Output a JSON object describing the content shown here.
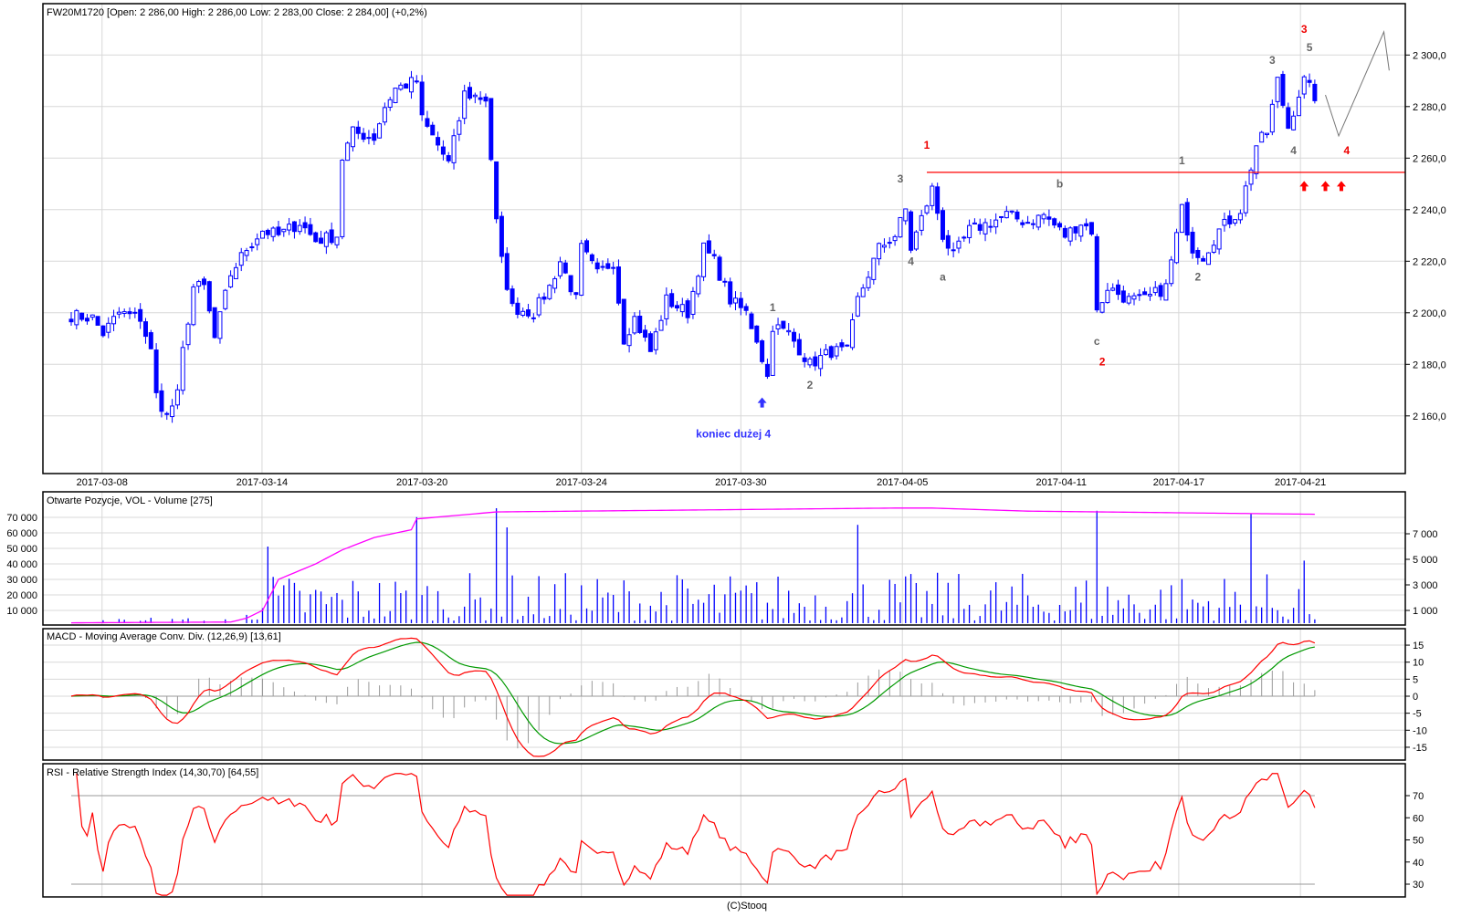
{
  "footer": "(C)Stooq",
  "chart_data": [
    {
      "type": "candlestick",
      "title": "FW20M1720 [Open: 2 286,00  High: 2 286,00  Low: 2 283,00  Close: 2 284,00] (+0,2%)",
      "ylim": [
        2140,
        2320
      ],
      "y_ticks": [
        {
          "value": 2160,
          "label": "2 160,0"
        },
        {
          "value": 2180,
          "label": "2 180,0"
        },
        {
          "value": 2200,
          "label": "2 200,0"
        },
        {
          "value": 2220,
          "label": "2 220,0"
        },
        {
          "value": 2240,
          "label": "2 240,0"
        },
        {
          "value": 2260,
          "label": "2 260,0"
        },
        {
          "value": 2280,
          "label": "2 280,0"
        },
        {
          "value": 2300,
          "label": "2 300,0"
        }
      ],
      "x_ticks": [
        {
          "bar": 5.8,
          "label": "2017-03-08"
        },
        {
          "bar": 35.9,
          "label": "2017-03-14"
        },
        {
          "bar": 66,
          "label": "2017-03-20"
        },
        {
          "bar": 96,
          "label": "2017-03-24"
        },
        {
          "bar": 126,
          "label": "2017-03-30"
        },
        {
          "bar": 156.4,
          "label": "2017-04-05"
        },
        {
          "bar": 186.3,
          "label": "2017-04-11"
        },
        {
          "bar": 208.4,
          "label": "2017-04-17"
        },
        {
          "bar": 231.3,
          "label": "2017-04-21"
        }
      ],
      "bar_count": 235,
      "close_path": [
        [
          0,
          2199
        ],
        [
          4,
          2198
        ],
        [
          6,
          2192
        ],
        [
          9,
          2200
        ],
        [
          13,
          2198
        ],
        [
          15,
          2185
        ],
        [
          16,
          2168
        ],
        [
          18,
          2160
        ],
        [
          20,
          2168
        ],
        [
          21,
          2185
        ],
        [
          23,
          2210
        ],
        [
          25,
          2210
        ],
        [
          27,
          2190
        ],
        [
          30,
          2215
        ],
        [
          33,
          2225
        ],
        [
          36,
          2232
        ],
        [
          39,
          2230
        ],
        [
          43,
          2235
        ],
        [
          46,
          2228
        ],
        [
          50,
          2230
        ],
        [
          51,
          2260
        ],
        [
          53,
          2270
        ],
        [
          57,
          2268
        ],
        [
          59,
          2280
        ],
        [
          61,
          2287
        ],
        [
          65,
          2290
        ],
        [
          66,
          2275
        ],
        [
          69,
          2265
        ],
        [
          71,
          2258
        ],
        [
          73,
          2275
        ],
        [
          74,
          2285
        ],
        [
          78,
          2283
        ],
        [
          79,
          2260
        ],
        [
          80,
          2235
        ],
        [
          81,
          2220
        ],
        [
          83,
          2202
        ],
        [
          87,
          2200
        ],
        [
          90,
          2210
        ],
        [
          92,
          2220
        ],
        [
          95,
          2205
        ],
        [
          96,
          2225
        ],
        [
          99,
          2215
        ],
        [
          102,
          2220
        ],
        [
          104,
          2190
        ],
        [
          106,
          2198
        ],
        [
          109,
          2185
        ],
        [
          112,
          2205
        ],
        [
          116,
          2200
        ],
        [
          119,
          2225
        ],
        [
          121,
          2220
        ],
        [
          124,
          2205
        ],
        [
          127,
          2200
        ],
        [
          129,
          2190
        ],
        [
          131,
          2175
        ],
        [
          132,
          2195
        ],
        [
          135,
          2192
        ],
        [
          139,
          2180
        ],
        [
          143,
          2185
        ],
        [
          146,
          2185
        ],
        [
          148,
          2205
        ],
        [
          150,
          2215
        ],
        [
          152,
          2225
        ],
        [
          155,
          2230
        ],
        [
          157,
          2240
        ],
        [
          158,
          2225
        ],
        [
          162,
          2248
        ],
        [
          164,
          2230
        ],
        [
          166,
          2222
        ],
        [
          169,
          2232
        ],
        [
          173,
          2235
        ],
        [
          176,
          2238
        ],
        [
          180,
          2235
        ],
        [
          183,
          2238
        ],
        [
          187,
          2230
        ],
        [
          190,
          2235
        ],
        [
          192,
          2232
        ],
        [
          193,
          2200
        ],
        [
          195,
          2210
        ],
        [
          199,
          2205
        ],
        [
          202,
          2205
        ],
        [
          206,
          2210
        ],
        [
          209,
          2240
        ],
        [
          211,
          2225
        ],
        [
          213,
          2222
        ],
        [
          216,
          2232
        ],
        [
          220,
          2240
        ],
        [
          223,
          2265
        ],
        [
          225,
          2270
        ],
        [
          227,
          2290
        ],
        [
          229,
          2272
        ],
        [
          231,
          2285
        ],
        [
          232,
          2290
        ],
        [
          234,
          2284
        ]
      ],
      "resistance_level": 2254.5,
      "resistance_from_bar": 161,
      "projection_path": [
        [
          236,
          2284.5
        ],
        [
          238.5,
          2268.6
        ],
        [
          247,
          2309
        ],
        [
          248,
          2294
        ]
      ],
      "wave_labels_gray": [
        {
          "text": "1",
          "bar": 132,
          "price": 2202
        },
        {
          "text": "2",
          "bar": 139,
          "price": 2172
        },
        {
          "text": "3",
          "bar": 156,
          "price": 2252
        },
        {
          "text": "4",
          "bar": 158,
          "price": 2220
        },
        {
          "text": "a",
          "bar": 164,
          "price": 2214
        },
        {
          "text": "b",
          "bar": 186,
          "price": 2250
        },
        {
          "text": "c",
          "bar": 193,
          "price": 2189
        },
        {
          "text": "1",
          "bar": 209,
          "price": 2259
        },
        {
          "text": "2",
          "bar": 212,
          "price": 2214
        },
        {
          "text": "3",
          "bar": 226,
          "price": 2298
        },
        {
          "text": "4",
          "bar": 230,
          "price": 2263
        },
        {
          "text": "5",
          "bar": 233,
          "price": 2303
        }
      ],
      "wave_labels_red": [
        {
          "text": "1",
          "bar": 161,
          "price": 2265
        },
        {
          "text": "2",
          "bar": 194,
          "price": 2181
        },
        {
          "text": "3",
          "bar": 232,
          "price": 2310
        },
        {
          "text": "4",
          "bar": 240,
          "price": 2263
        }
      ],
      "note": {
        "text": "koniec dużej 4",
        "bar": 124.6,
        "price": 2153
      },
      "blue_arrow": {
        "bar": 130,
        "price": 2165
      },
      "red_arrows": [
        {
          "bar": 232,
          "price": 2249
        },
        {
          "bar": 236,
          "price": 2249
        },
        {
          "bar": 239,
          "price": 2249
        }
      ],
      "colors": {
        "candle": "#0000ff",
        "resistance": "#ff0000",
        "gray_label": "#666666",
        "red_label": "#ee0000",
        "note": "#3333ff",
        "projection": "#777777"
      }
    },
    {
      "type": "bar+line",
      "title": "Otwarte Pozycje, VOL - Volume [275]",
      "left_ticks": [
        {
          "value": 10000,
          "label": "10 000"
        },
        {
          "value": 20000,
          "label": "20 000"
        },
        {
          "value": 30000,
          "label": "30 000"
        },
        {
          "value": 40000,
          "label": "40 000"
        },
        {
          "value": 50000,
          "label": "50 000"
        },
        {
          "value": 60000,
          "label": "60 000"
        },
        {
          "value": 70000,
          "label": "70 000"
        }
      ],
      "right_ticks": [
        {
          "value": 1000,
          "label": "1 000"
        },
        {
          "value": 3000,
          "label": "3 000"
        },
        {
          "value": 5000,
          "label": "5 000"
        },
        {
          "value": 7000,
          "label": "7 000"
        }
      ],
      "open_interest_path": [
        [
          0,
          2000
        ],
        [
          30,
          2500
        ],
        [
          33,
          5000
        ],
        [
          36,
          10000
        ],
        [
          39,
          30000
        ],
        [
          46,
          40000
        ],
        [
          51,
          49000
        ],
        [
          57,
          57000
        ],
        [
          64,
          62000
        ],
        [
          65,
          69000
        ],
        [
          80,
          73500
        ],
        [
          155,
          76000
        ],
        [
          162,
          76000
        ],
        [
          180,
          74000
        ],
        [
          234,
          72000
        ]
      ],
      "volume_spikes": [
        [
          37,
          6000
        ],
        [
          65,
          8300
        ],
        [
          80,
          9000
        ],
        [
          82,
          7500
        ],
        [
          148,
          7700
        ],
        [
          193,
          8800
        ],
        [
          222,
          8600
        ],
        [
          232,
          4900
        ],
        [
          234,
          300
        ]
      ],
      "colors": {
        "volume": "#0000ff",
        "open_interest": "#ff00ff"
      }
    },
    {
      "type": "line",
      "title": "MACD - Moving Average Conv. Div. (12,26,9) [13,61]",
      "params": [
        12,
        26,
        9
      ],
      "y_ticks": [
        {
          "value": 15,
          "label": "15"
        },
        {
          "value": 10,
          "label": "10"
        },
        {
          "value": 5,
          "label": "5"
        },
        {
          "value": 0,
          "label": "0"
        },
        {
          "value": -5,
          "label": "-5"
        },
        {
          "value": -10,
          "label": "-10"
        },
        {
          "value": -15,
          "label": "-15"
        }
      ],
      "colors": {
        "macd": "#ff0000",
        "signal": "#009900",
        "histogram": "#999999"
      }
    },
    {
      "type": "line",
      "title": "RSI - Relative Strength Index (14,30,70) [64,55]",
      "period": 14,
      "levels": [
        30,
        70
      ],
      "y_ticks": [
        {
          "value": 70,
          "label": "70"
        },
        {
          "value": 60,
          "label": "60"
        },
        {
          "value": 50,
          "label": "50"
        },
        {
          "value": 40,
          "label": "40"
        },
        {
          "value": 30,
          "label": "30"
        }
      ],
      "colors": {
        "rsi": "#ff0000",
        "level": "#999999"
      }
    }
  ]
}
